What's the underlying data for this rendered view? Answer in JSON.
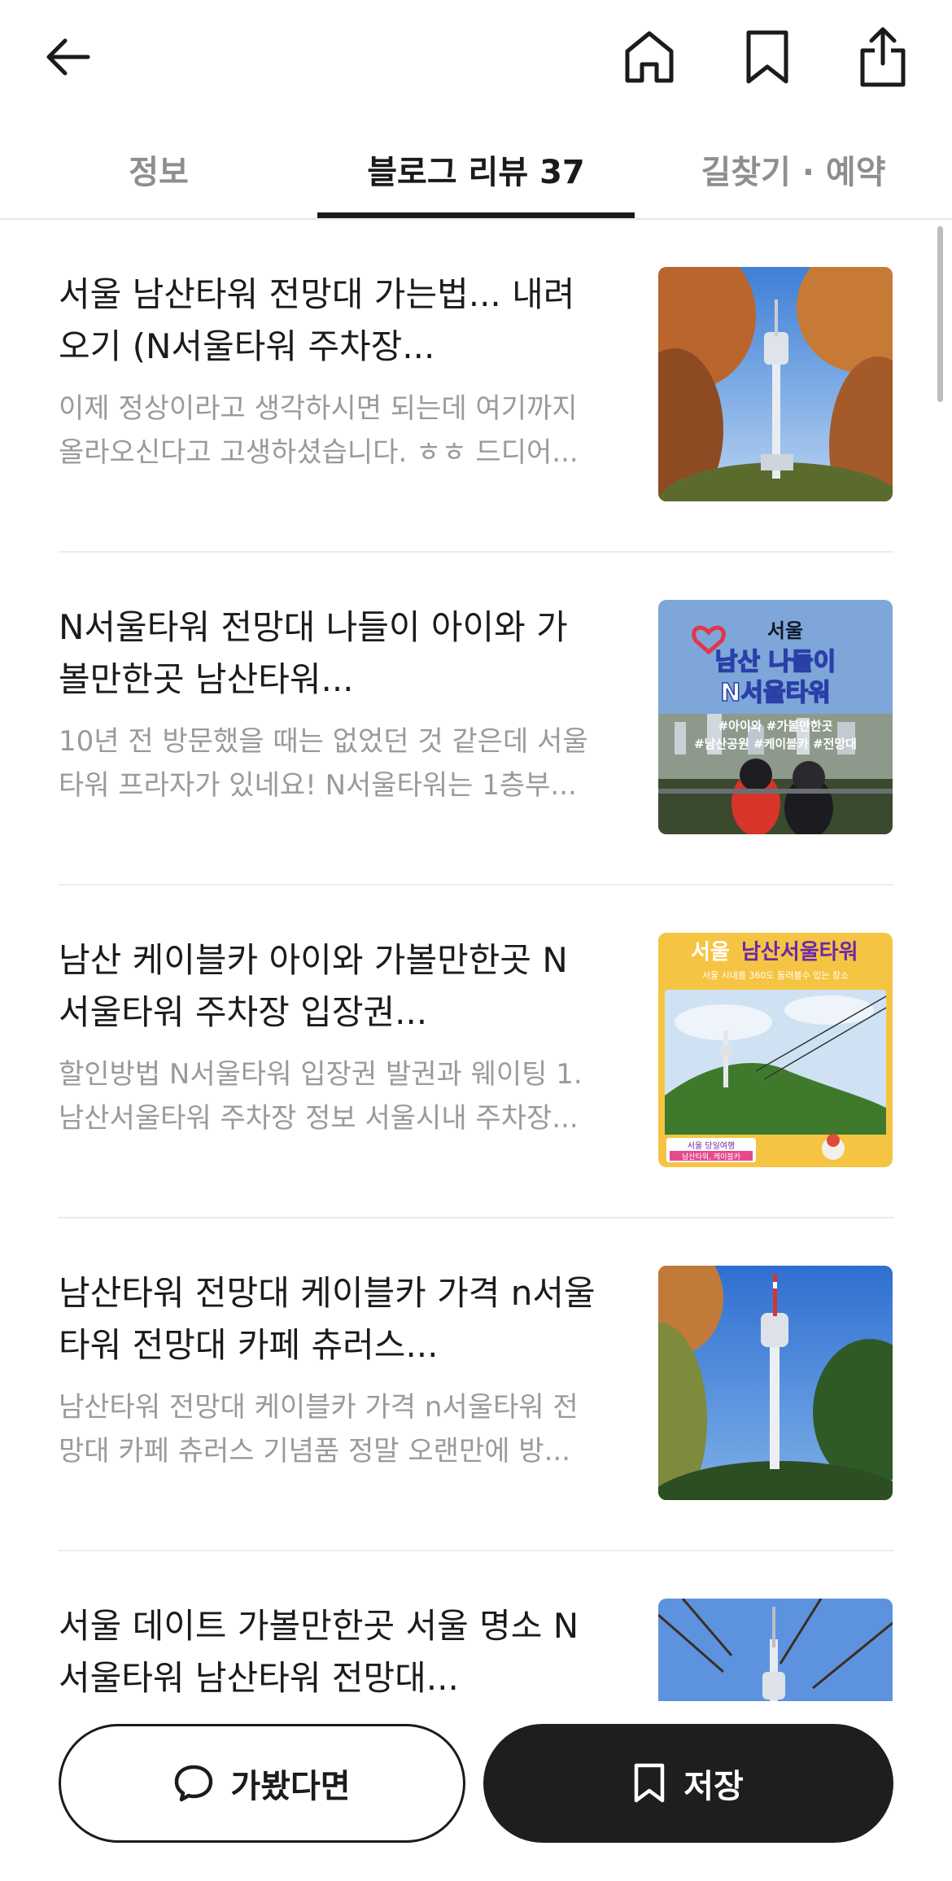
{
  "header": {
    "back_icon": "back-arrow-icon",
    "home_icon": "home-icon",
    "bookmark_icon": "bookmark-icon",
    "share_icon": "share-icon"
  },
  "tabs": [
    {
      "label": "정보",
      "active": false
    },
    {
      "label": "블로그 리뷰 37",
      "active": true
    },
    {
      "label": "길찾기 · 예약",
      "active": false
    }
  ],
  "reviews": [
    {
      "title": "서울 남산타워 전망대 가는법... 내려오기 (N서울타워 주차장...",
      "snippet": "이제 정상이라고 생각하시면 되는데 여기까지 올라오신다고 고생하셨습니다. ㅎㅎ 드디어...",
      "thumb": "tower-autumn-photo"
    },
    {
      "title": "N서울타워 전망대 나들이 아이와 가볼만한곳 남산타워...",
      "snippet": "10년 전 방문했을 때는 없었던 것 같은데 서울타워 프라자가 있네요! N서울타워는 1층부...",
      "thumb": "blog-cover-graphic",
      "thumb_text": {
        "top": "서울",
        "line1": "남산 나들이",
        "line2": "N서울타워",
        "tags1": "#아이와 #가볼만한곳",
        "tags2": "#남산공원 #케이블카 #전망대"
      }
    },
    {
      "title": "남산 케이블카 아이와 가볼만한곳 N서울타워 주차장 입장권...",
      "snippet": "할인방법 N서울타워 입장권 발권과 웨이팅 1. 남산서울타워 주차장 정보 서울시내 주차장...",
      "thumb": "yellow-poster-graphic",
      "thumb_text": {
        "title_a": "서울",
        "title_b": "남산서울타워",
        "subtitle": "서울 시내를 360도 둘러볼수 있는 장소",
        "badge1": "서울 당일여행",
        "badge2": "남산타워, 케이블카"
      }
    },
    {
      "title": "남산타워 전망대 케이블카 가격 n서울타워 전망대 카페 츄러스...",
      "snippet": "남산타워 전망대 케이블카 가격 n서울타워 전망대 카페 츄러스 기념품 정말 오랜만에 방...",
      "thumb": "tower-blue-sky-photo"
    },
    {
      "title": "서울 데이트 가볼만한곳 서울 명소 N서울타워 남산타워 전망대...",
      "snippet": "",
      "thumb": "tower-branches-photo"
    }
  ],
  "bottom": {
    "visited_label": "가봤다면",
    "visited_icon": "chat-bubble-icon",
    "save_label": "저장",
    "save_icon": "bookmark-icon"
  },
  "colors": {
    "accent": "#1e1e1e",
    "muted_text": "#9a9a9a",
    "divider": "#ececec"
  }
}
